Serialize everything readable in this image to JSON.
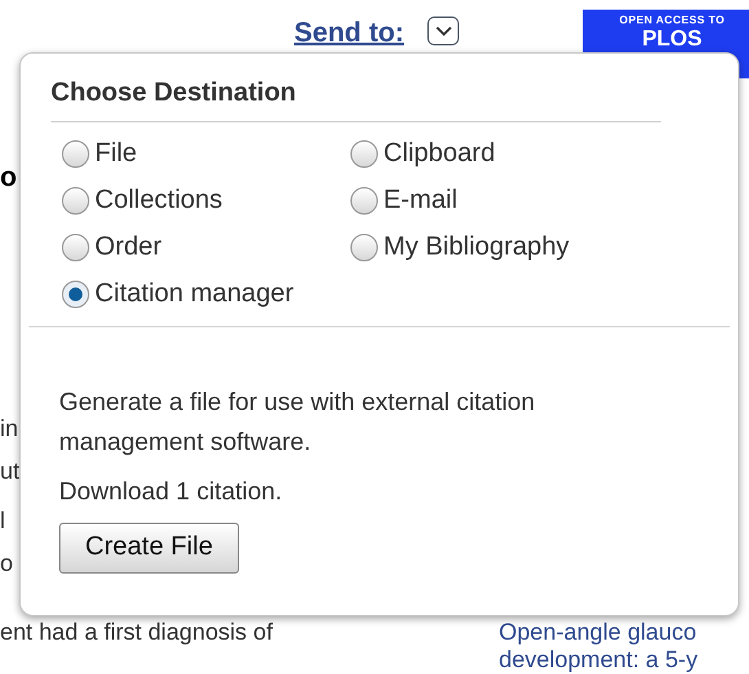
{
  "header": {
    "send_to": "Send to:",
    "banner": {
      "line_1": "OPEN ACCESS TO",
      "line_2": "PLOS"
    }
  },
  "background": {
    "left_heading": "o",
    "left_lines": [
      "in",
      "ut",
      "l",
      "o",
      "ent had a first diagnosis of"
    ],
    "right_lines": [
      "Open-angle glauco",
      "development: a 5-y"
    ]
  },
  "popup": {
    "title": "Choose Destination",
    "options": [
      {
        "label": "File",
        "selected": false
      },
      {
        "label": "Clipboard",
        "selected": false
      },
      {
        "label": "Collections",
        "selected": false
      },
      {
        "label": "E-mail",
        "selected": false
      },
      {
        "label": "Order",
        "selected": false
      },
      {
        "label": "My Bibliography",
        "selected": false
      },
      {
        "label": "Citation manager",
        "selected": true
      }
    ],
    "description": "Generate a file for use with external citation management software.",
    "count_text": "Download 1 citation.",
    "button": "Create File"
  }
}
